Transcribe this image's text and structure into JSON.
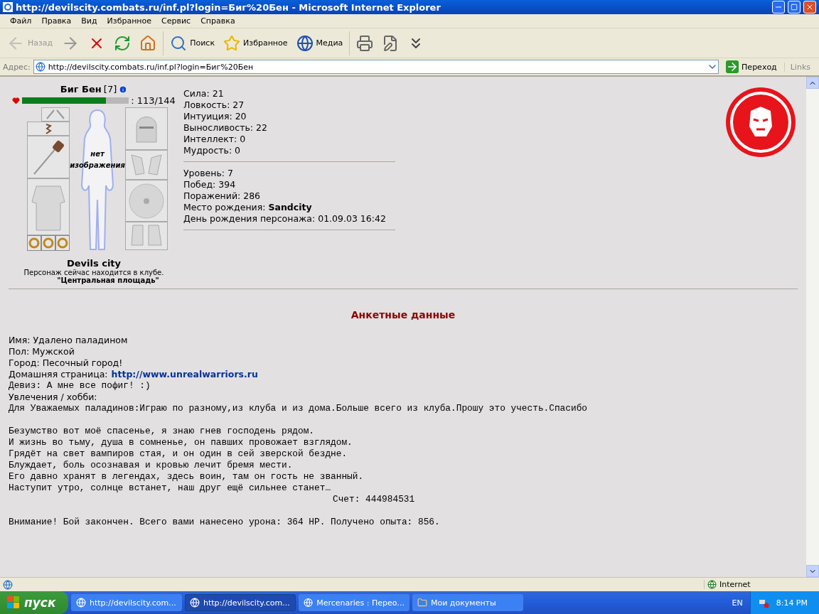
{
  "window": {
    "title": "http://devilscity.combats.ru/inf.pl?login=Биг%20Бен - Microsoft Internet Explorer"
  },
  "menu": [
    "Файл",
    "Правка",
    "Вид",
    "Избранное",
    "Сервис",
    "Справка"
  ],
  "toolbar": [
    {
      "kind": "back",
      "label": "Назад",
      "disabled": true
    },
    {
      "kind": "forward"
    },
    {
      "kind": "stop"
    },
    {
      "kind": "refresh"
    },
    {
      "kind": "home"
    },
    {
      "kind": "search",
      "label": "Поиск"
    },
    {
      "kind": "favorites",
      "label": "Избранное"
    },
    {
      "kind": "media",
      "label": "Медиа"
    },
    {
      "kind": "print"
    },
    {
      "kind": "edit"
    },
    {
      "kind": "more"
    }
  ],
  "address": {
    "label": "Адрес:",
    "value": "http://devilscity.combats.ru/inf.pl?login=Биг%20Бен",
    "go": "Переход",
    "links": "Links"
  },
  "profile": {
    "name": "Биг Бен",
    "level": "[7]",
    "hp": {
      "level": 0.785,
      "reading": ": 113/144"
    },
    "no_image": "нет изображения",
    "city": "Devils city",
    "location": "Персонаж сейчас находится в клубе.",
    "place": "\"Центральная площадь\""
  },
  "stats": [
    [
      "Сила: 21",
      "Ловкость: 27",
      "Интуиция: 20",
      "Выносливость: 22",
      "Интеллект: 0",
      "Мудрость: 0"
    ],
    [
      "Уровень: 7",
      "Побед: 394",
      "Поражений: 286",
      "Место рождения: **Sandcity**",
      "День рождения персонажа: 01.09.03 16:42"
    ]
  ],
  "section_title": "Анкетные данные",
  "info": [
    {
      "kind": "text",
      "text": "Имя: Удалено паладином"
    },
    {
      "kind": "text",
      "text": "Пол: Мужской"
    },
    {
      "kind": "text",
      "text": "Город: Песочный город!"
    },
    {
      "kind": "link",
      "text": "Домашняя страница:",
      "link": "http://www.unrealwarriors.ru"
    }
  ],
  "mono": [
    {
      "kind": "line",
      "text": "Девиз: А мне все пофиг! :)"
    },
    {
      "kind": "sans",
      "text": "Увлечения / хобби:"
    },
    {
      "kind": "line",
      "text": "Для Уважаемых паладинов:Играю по разному,из клуба и из дома.Больше всего из клуба.Прошу это учесть.Спасибо"
    },
    {
      "kind": "gap"
    },
    {
      "kind": "line",
      "text": "Безумство вот моё спасенье, я знаю гнев господень рядом."
    },
    {
      "kind": "line",
      "text": "И жизнь во тьму, душа в сомненье, он павших провожает взглядом."
    },
    {
      "kind": "line",
      "text": "Грядёт на свет вампиров стая, и он один в сей зверской бездне."
    },
    {
      "kind": "line",
      "text": "Блуждает, боль осознавая и кровью лечит бремя мести."
    },
    {
      "kind": "line",
      "text": "Его давно хранят в легендах, здесь воин, там он гость не званный."
    },
    {
      "kind": "line",
      "text": "Наступит утро, солнце встанет, наш друг ещё сильнее станет…"
    },
    {
      "kind": "indent",
      "text": "Счет: 444984531"
    },
    {
      "kind": "gap"
    },
    {
      "kind": "line",
      "text": "Внимание! Бой закончен. Всего вами нанесено урона: 364 HP. Получено опыта: 856."
    }
  ],
  "status_bar": {
    "zone": "Internet"
  },
  "taskbar": {
    "start": "пуск",
    "tasks": [
      {
        "label": "http://devilscity.com...",
        "selected": false
      },
      {
        "label": "http://devilscity.com...",
        "selected": true
      },
      {
        "label": "Mercenaries : Перео...",
        "selected": false
      },
      {
        "label": "Мои документы",
        "selected": false,
        "kind": "folder"
      }
    ],
    "lang": "EN",
    "clock": "8:14 PM"
  }
}
